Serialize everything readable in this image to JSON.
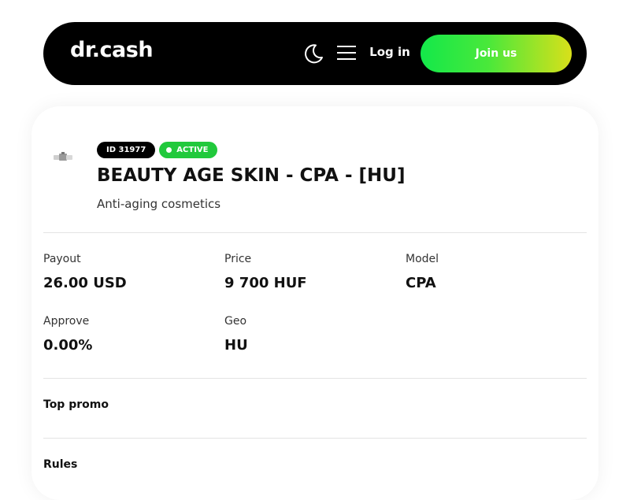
{
  "header": {
    "logo": "dr.cash",
    "theme_toggle_icon": "moon-icon",
    "menu_icon": "hamburger-menu-icon",
    "login_label": "Log in",
    "join_label": "Join us"
  },
  "offer": {
    "id_badge": "ID 31977",
    "status_badge": "ACTIVE",
    "title": "BEAUTY AGE SKIN - CPA - [HU]",
    "subtitle": "Anti-aging cosmetics",
    "stats": [
      {
        "label": "Payout",
        "value": "26.00 USD"
      },
      {
        "label": "Price",
        "value": "9 700 HUF"
      },
      {
        "label": "Model",
        "value": "CPA"
      },
      {
        "label": "Approve",
        "value": "0.00%"
      },
      {
        "label": "Geo",
        "value": "HU"
      }
    ],
    "sections": {
      "top_promo": "Top promo",
      "rules": "Rules"
    }
  },
  "colors": {
    "navbar_bg": "#000000",
    "accent_green": "#21c93c",
    "join_gradient_start": "#13e84a",
    "join_gradient_end": "#d9e01a"
  }
}
